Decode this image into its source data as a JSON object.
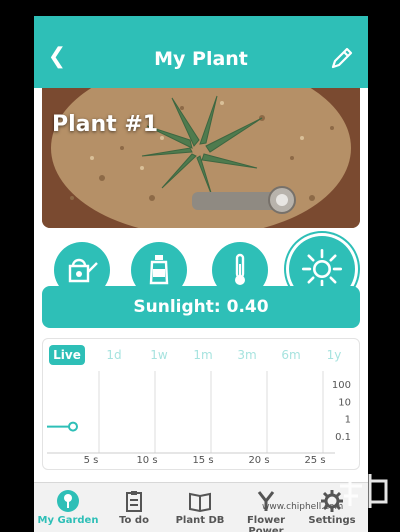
{
  "header": {
    "title": "My Plant",
    "back_icon": "back-chevron-icon",
    "edit_icon": "pencil-icon"
  },
  "plant": {
    "name": "Plant #1"
  },
  "sensors": [
    {
      "id": "water",
      "icon": "watering-can-icon",
      "selected": false
    },
    {
      "id": "fertilizer",
      "icon": "fertilizer-bottle-icon",
      "selected": false
    },
    {
      "id": "temperature",
      "icon": "thermometer-icon",
      "selected": false
    },
    {
      "id": "sunlight",
      "icon": "sun-icon",
      "selected": true
    }
  ],
  "readout": {
    "text": "Sunlight: 0.40"
  },
  "graph": {
    "tabs": [
      "Live",
      "1d",
      "1w",
      "1m",
      "3m",
      "6m",
      "1y"
    ],
    "active_tab": "Live"
  },
  "chart_data": {
    "type": "line",
    "x_ticks": [
      "5 s",
      "10 s",
      "15 s",
      "20 s",
      "25 s"
    ],
    "y_ticks": [
      "100",
      "10",
      "1",
      "0.1"
    ],
    "y_scale": "log",
    "series": [
      {
        "values": [
          [
            0,
            0.4
          ]
        ]
      }
    ]
  },
  "nav": {
    "items": [
      {
        "label": "My Garden",
        "icon": "flower-icon",
        "active": true
      },
      {
        "label": "To do",
        "icon": "clipboard-icon",
        "active": false
      },
      {
        "label": "Plant DB",
        "icon": "book-icon",
        "active": false
      },
      {
        "label": "Flower Power",
        "icon": "flower-power-icon",
        "active": false
      },
      {
        "label": "Settings",
        "icon": "gear-icon",
        "active": false
      }
    ]
  },
  "colors": {
    "accent": "#2ebfb7",
    "tab_inactive": "#a7e3df"
  },
  "watermark": {
    "text": "www.chiphell.com"
  }
}
